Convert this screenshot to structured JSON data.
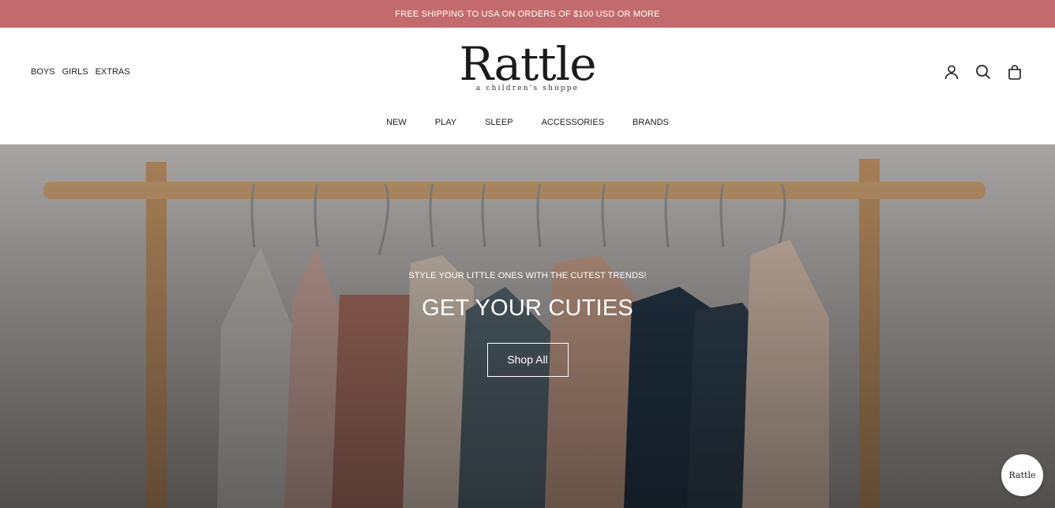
{
  "announcement": "FREE SHIPPING TO USA ON ORDERS OF $100 USD OR MORE",
  "header": {
    "left_nav": [
      "BOYS",
      "GIRLS",
      "EXTRAS"
    ],
    "logo": {
      "name": "Rattle",
      "tagline": "a children's shoppe"
    },
    "main_nav": [
      "NEW",
      "PLAY",
      "SLEEP",
      "ACCESSORIES",
      "BRANDS"
    ],
    "icons": [
      "account-icon",
      "search-icon",
      "cart-bag-icon"
    ]
  },
  "hero": {
    "subtitle": "STYLE YOUR LITTLE ONES WITH THE CUTEST TRENDS!",
    "title": "GET YOUR CUTIES",
    "button_label": "Shop All"
  },
  "chat_badge": {
    "label": "Rattle"
  },
  "colors": {
    "announcement_bg": "#c36b6c",
    "text": "#1c1c1c",
    "hero_overlay": "#000000"
  }
}
